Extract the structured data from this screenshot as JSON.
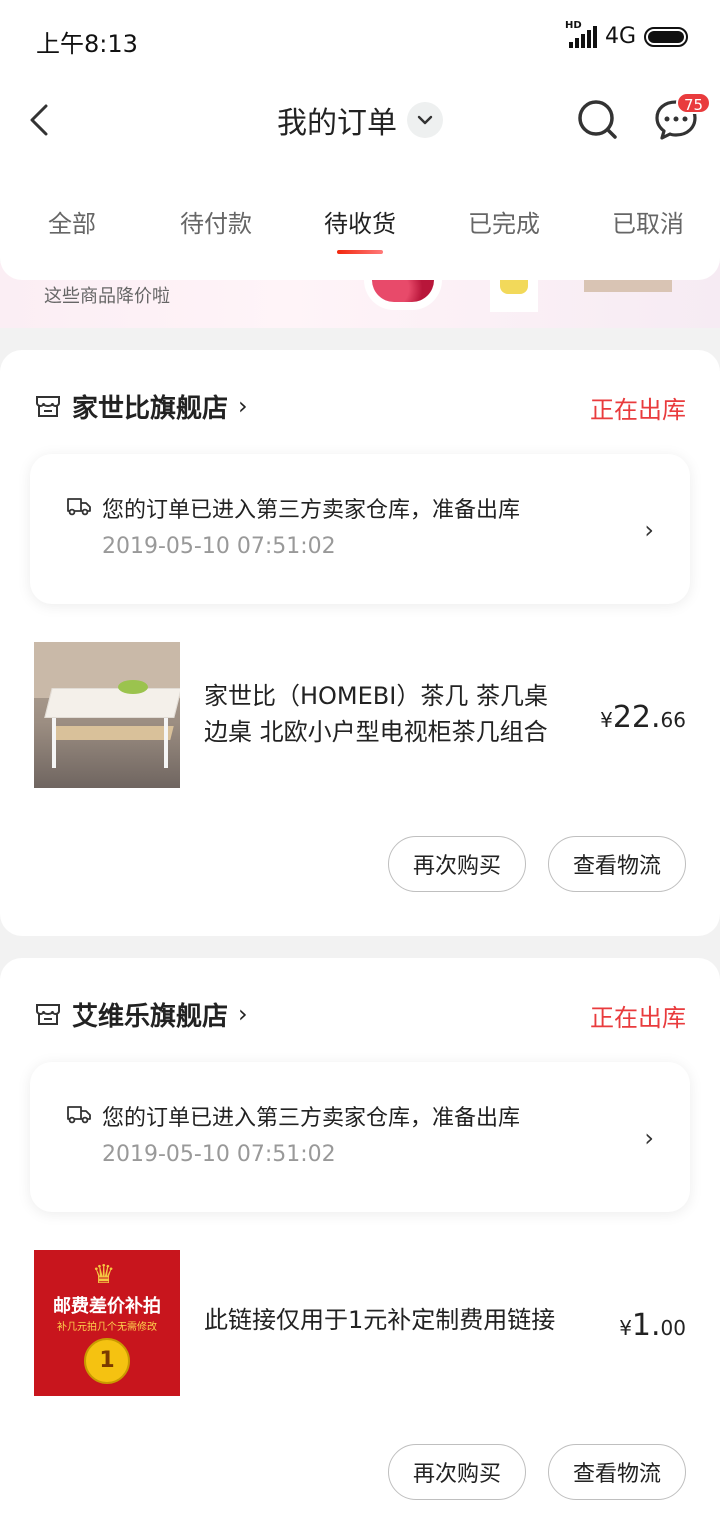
{
  "status_bar": {
    "time": "上午8:13",
    "network": "4G",
    "signal_label": "HD"
  },
  "header": {
    "title": "我的订单",
    "badge_count": "75"
  },
  "tabs": [
    {
      "label": "全部",
      "active": false
    },
    {
      "label": "待付款",
      "active": false
    },
    {
      "label": "待收货",
      "active": true
    },
    {
      "label": "已完成",
      "active": false
    },
    {
      "label": "已取消",
      "active": false
    }
  ],
  "promo": {
    "text": "这些商品降价啦"
  },
  "orders": [
    {
      "shop_name": "家世比旗舰店",
      "status": "正在出库",
      "tracking_message": "您的订单已进入第三方卖家仓库，准备出库",
      "tracking_time": "2019-05-10 07:51:02",
      "product_name": "家世比（HOMEBI）茶几 茶几桌 边桌 北欧小户型电视柜茶几组合",
      "price_currency": "¥",
      "price_int": "22.",
      "price_dec": "66",
      "rebuy_label": "再次购买",
      "logistics_label": "查看物流"
    },
    {
      "shop_name": "艾维乐旗舰店",
      "status": "正在出库",
      "tracking_message": "您的订单已进入第三方卖家仓库，准备出库",
      "tracking_time": "2019-05-10 07:51:02",
      "product_name": "此链接仅用于1元补定制费用链接",
      "product_image_text": {
        "title": "邮费差价补拍",
        "subtitle": "补几元拍几个无需修改",
        "coin": "1"
      },
      "price_currency": "¥",
      "price_int": "1.",
      "price_dec": "00",
      "rebuy_label": "再次购买",
      "logistics_label": "查看物流"
    }
  ],
  "colors": {
    "accent_red": "#e93b3d",
    "background": "#f2f2f2"
  },
  "icons": [
    "back-icon",
    "chevron-down-icon",
    "search-icon",
    "message-icon",
    "store-icon",
    "truck-icon",
    "chevron-right-icon"
  ]
}
